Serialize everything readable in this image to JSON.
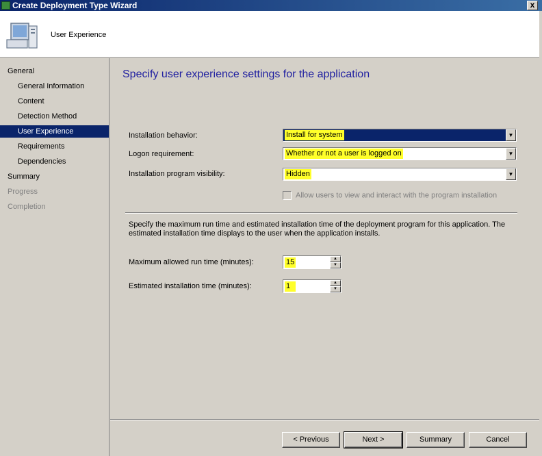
{
  "window": {
    "title": "Create Deployment Type Wizard",
    "close_label": "x",
    "header_title": "User Experience"
  },
  "sidebar": {
    "items": [
      {
        "label": "General"
      },
      {
        "label": "General Information"
      },
      {
        "label": "Content"
      },
      {
        "label": "Detection Method"
      },
      {
        "label": "User Experience"
      },
      {
        "label": "Requirements"
      },
      {
        "label": "Dependencies"
      },
      {
        "label": "Summary"
      },
      {
        "label": "Progress"
      },
      {
        "label": "Completion"
      }
    ]
  },
  "main": {
    "page_title": "Specify user experience settings for the application",
    "installation_behavior": {
      "label": "Installation behavior:",
      "value": "Install for system"
    },
    "logon_requirement": {
      "label": "Logon requirement:",
      "value": "Whether or not a user is logged on"
    },
    "program_visibility": {
      "label": "Installation program visibility:",
      "value": "Hidden"
    },
    "allow_interact": {
      "label": "Allow users to view and interact with the program installation"
    },
    "description": "Specify the maximum run time and estimated installation time of the deployment program for this application. The estimated installation time displays to the user when the application installs.",
    "max_run_time": {
      "label": "Maximum allowed run time (minutes):",
      "value": "15"
    },
    "est_install_time": {
      "label": "Estimated installation time (minutes):",
      "value": "1"
    }
  },
  "buttons": {
    "previous": "< Previous",
    "next": "Next >",
    "summary": "Summary",
    "cancel": "Cancel"
  },
  "colors": {
    "highlight": "#ffff2a",
    "selection": "#0a246a",
    "title_text": "#1f1fa0"
  }
}
